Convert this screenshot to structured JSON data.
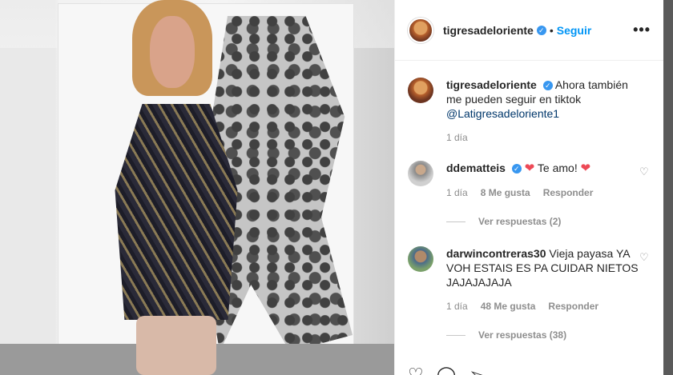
{
  "post": {
    "username": "tigresadeloriente",
    "follow_label": "Seguir",
    "more_label": "•••"
  },
  "caption": {
    "username": "tigresadeloriente",
    "text": "Ahora también me pueden seguir en tiktok",
    "mention": "@Latigresadeloriente1",
    "time": "1 día"
  },
  "comments": [
    {
      "username": "ddematteis",
      "text": "Te amo!",
      "time": "1 día",
      "likes": "8 Me gusta",
      "reply_label": "Responder",
      "replies_label": "Ver respuestas (2)"
    },
    {
      "username": "darwincontreras30",
      "text": "Vieja payasa YA VOH ESTAIS ES PA CUIDAR NIETOS JAJAJAJAJA",
      "time": "1 día",
      "likes": "48 Me gusta",
      "reply_label": "Responder",
      "replies_label": "Ver respuestas (38)"
    }
  ],
  "icons": {
    "verified": "verified-badge-icon",
    "heart": "heart-icon",
    "comment": "comment-icon",
    "share": "share-icon",
    "save": "bookmark-icon"
  },
  "colors": {
    "accent": "#0095f6",
    "verified": "#3897f0",
    "heart_red": "#ed4956"
  }
}
